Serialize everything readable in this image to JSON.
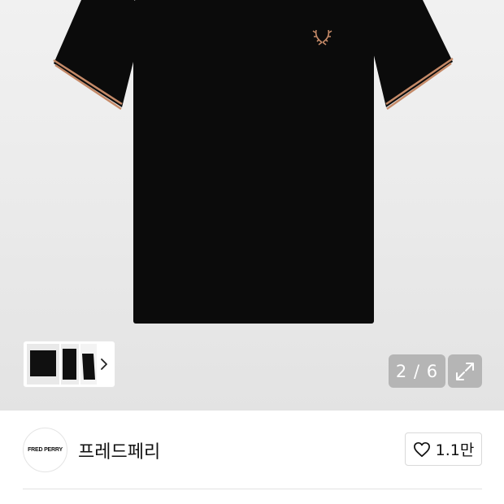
{
  "gallery": {
    "counter": "2 / 6",
    "icons": {
      "expand": "expand-icon",
      "thumb_next": "chevron-right-icon"
    }
  },
  "brand": {
    "logo_text": "FRED PERRY",
    "name": "프레드페리"
  },
  "like": {
    "count": "1.1만",
    "icon": "heart-outline-icon"
  },
  "colors": {
    "shirt": "#0b0b0b",
    "tipping": "#c58a68",
    "overlay": "#b5b5b5"
  }
}
